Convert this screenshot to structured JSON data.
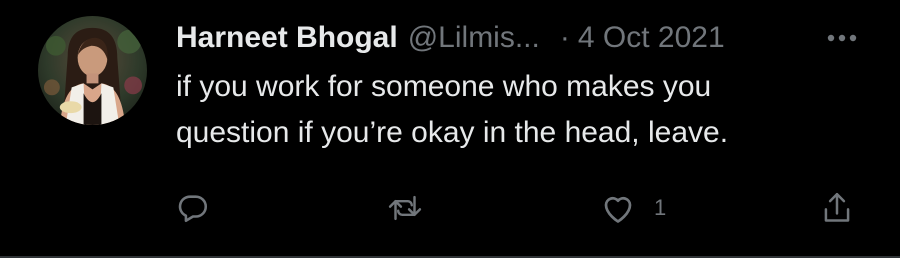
{
  "tweet": {
    "author_name": "Harneet Bhogal",
    "handle": "@Lilmis...",
    "separator": "·",
    "date": "4 Oct 2021",
    "text_lines": [
      "if you work for someone who makes you",
      "question if you’re okay in the head, leave."
    ]
  },
  "actions": {
    "reply_icon": "reply-icon",
    "retweet_icon": "retweet-icon",
    "like_icon": "heart-icon",
    "like_count": "1",
    "share_icon": "share-icon"
  },
  "colors": {
    "background": "#000000",
    "primary_text": "#e7e9ea",
    "secondary_text": "#71767b",
    "divider": "#2f3336"
  }
}
